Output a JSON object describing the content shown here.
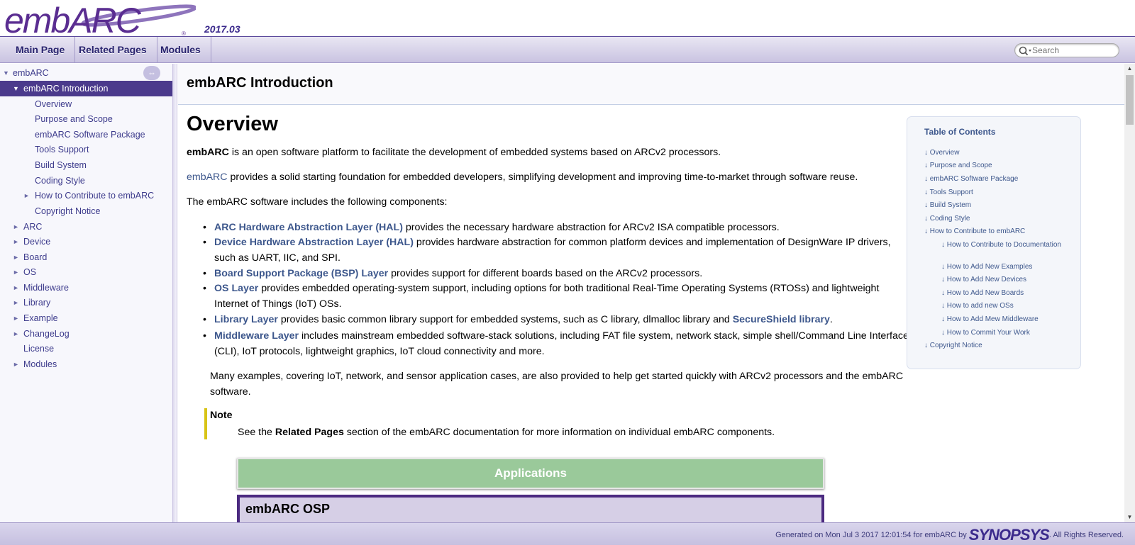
{
  "brand": {
    "logo_text": "embARC",
    "version": "2017.03"
  },
  "nav": {
    "tabs": [
      "Main Page",
      "Related Pages",
      "Modules"
    ],
    "search_placeholder": "Search"
  },
  "sidebar": {
    "items": [
      {
        "label": "embARC",
        "arrow": "▼"
      },
      {
        "label": "embARC Introduction",
        "arrow": "▼"
      },
      {
        "label": "Overview",
        "arrow": ""
      },
      {
        "label": "Purpose and Scope",
        "arrow": ""
      },
      {
        "label": "embARC Software Package",
        "arrow": ""
      },
      {
        "label": "Tools Support",
        "arrow": ""
      },
      {
        "label": "Build System",
        "arrow": ""
      },
      {
        "label": "Coding Style",
        "arrow": ""
      },
      {
        "label": "How to Contribute to embARC",
        "arrow": "►"
      },
      {
        "label": "Copyright Notice",
        "arrow": ""
      },
      {
        "label": "ARC",
        "arrow": "►"
      },
      {
        "label": "Device",
        "arrow": "►"
      },
      {
        "label": "Board",
        "arrow": "►"
      },
      {
        "label": "OS",
        "arrow": "►"
      },
      {
        "label": "Middleware",
        "arrow": "►"
      },
      {
        "label": "Library",
        "arrow": "►"
      },
      {
        "label": "Example",
        "arrow": "►"
      },
      {
        "label": "ChangeLog",
        "arrow": "►"
      },
      {
        "label": "License",
        "arrow": ""
      },
      {
        "label": "Modules",
        "arrow": "►"
      }
    ],
    "sync_icon": "sync-arrows"
  },
  "content": {
    "page_title": "embARC Introduction",
    "heading": "Overview",
    "p1_bold": "embARC",
    "p1_rest": " is an open software platform to facilitate the development of embedded systems based on ARCv2 processors.",
    "p2_link": "embARC",
    "p2_rest": " provides a solid starting foundation for embedded developers, simplifying development and improving time-to-market through software reuse.",
    "p3": "The embARC software includes the following components:",
    "bullets": [
      {
        "link": "ARC Hardware Abstraction Layer (HAL)",
        "text": " provides the necessary hardware abstraction for ARCv2 ISA compatible processors."
      },
      {
        "link": "Device Hardware Abstraction Layer (HAL)",
        "text": " provides hardware abstraction for common platform devices and implementation of DesignWare IP drivers, such as UART, IIC, and SPI."
      },
      {
        "link": "Board Support Package (BSP) Layer",
        "text": " provides support for different boards based on the ARCv2 processors."
      },
      {
        "link": "OS Layer",
        "text": " provides embedded operating-system support, including options for both traditional Real-Time Operating Systems (RTOSs) and lightweight Internet of Things (IoT) OSs."
      },
      {
        "link": "Library Layer",
        "text": " provides basic common library support for embedded systems, such as C library, dlmalloc library and ",
        "link2": "SecureShield library",
        "tail": "."
      },
      {
        "link": "Middleware Layer",
        "text": " includes mainstream embedded software-stack solutions, including FAT file system, network stack, simple shell/Command Line Interface (CLI), IoT protocols, lightweight graphics, IoT cloud connectivity and more."
      }
    ],
    "p4": "Many examples, covering IoT, network, and sensor application cases, are also provided to help get started quickly with ARCv2 processors and the embARC software.",
    "note_title": "Note",
    "note_pre": "See the ",
    "note_bold": "Related Pages",
    "note_post": " section of the embARC documentation for more information on individual embARC components.",
    "diagram_app": "Applications",
    "diagram_osp": "embARC OSP"
  },
  "toc": {
    "title": "Table of Contents",
    "l1": [
      "Overview",
      "Purpose and Scope",
      "embARC Software Package",
      "Tools Support",
      "Build System",
      "Coding Style",
      "How to Contribute to embARC"
    ],
    "l2": [
      "How to Contribute to Documentation",
      "How to Add New Examples",
      "How to Add New Devices",
      "How to Add New Boards",
      "How to add new OSs",
      "How to Add Mew Middleware",
      "How to Commit Your Work"
    ],
    "last": "Copyright Notice"
  },
  "footer": {
    "generated": "Generated on Mon Jul 3 2017 12:01:54 for embARC by",
    "company": "SYNOPSYS",
    "rights": ". All Rights Reserved."
  },
  "colors": {
    "accent": "#4b3a8c",
    "link": "#3d578c",
    "note_bar": "#d8c417",
    "app_box": "#9ac99a"
  }
}
